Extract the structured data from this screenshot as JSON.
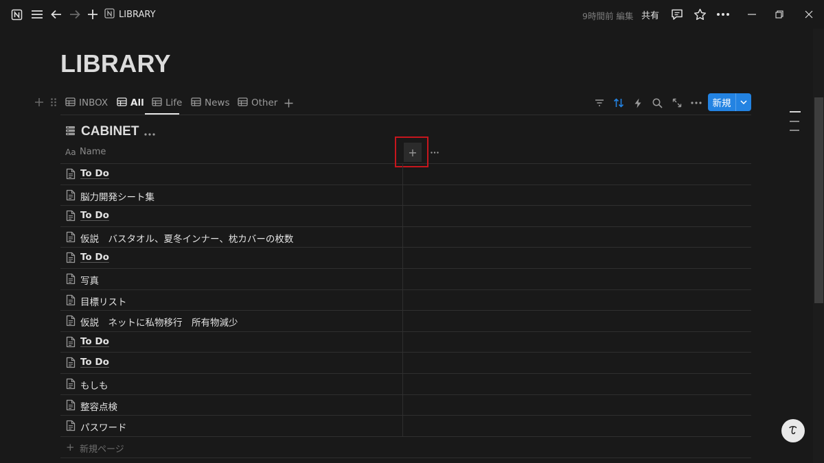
{
  "topbar": {
    "breadcrumb_label": "LIBRARY",
    "edited_text": "9時間前 編集",
    "share_label": "共有",
    "icons": [
      "notion-logo-icon",
      "menu-icon",
      "back-arrow-icon",
      "forward-arrow-icon",
      "plus-icon",
      "page-icon",
      "comment-icon",
      "star-icon",
      "more-icon",
      "minimize-icon",
      "restore-icon",
      "close-icon"
    ]
  },
  "page": {
    "title": "LIBRARY"
  },
  "views": {
    "tabs": [
      {
        "label": "INBOX",
        "active": false
      },
      {
        "label": "All",
        "active": true
      },
      {
        "label": "Life",
        "active": false
      },
      {
        "label": "News",
        "active": false
      },
      {
        "label": "Other",
        "active": false
      }
    ],
    "toolbar_icons": [
      "filter-icon",
      "sort-icon",
      "automation-icon",
      "search-icon",
      "expand-icon",
      "more-icon"
    ],
    "new_button_label": "新規"
  },
  "database": {
    "title": "CABINET",
    "header": {
      "type_label": "Aa",
      "name_label": "Name",
      "add_column_label": "+"
    },
    "rows": [
      {
        "label": "To Do",
        "bold": true
      },
      {
        "label": "脳力開発シート集",
        "bold": false
      },
      {
        "label": "To Do",
        "bold": true
      },
      {
        "label": "仮説　バスタオル、夏冬インナー、枕カバーの枚数",
        "bold": false
      },
      {
        "label": "To Do",
        "bold": true
      },
      {
        "label": "写真",
        "bold": false
      },
      {
        "label": "目標リスト",
        "bold": false
      },
      {
        "label": "仮説　ネットに私物移行　所有物減少",
        "bold": false
      },
      {
        "label": "To Do",
        "bold": true
      },
      {
        "label": "To Do",
        "bold": true
      },
      {
        "label": "もしも",
        "bold": false
      },
      {
        "label": "整容点検",
        "bold": false
      },
      {
        "label": "パスワード",
        "bold": false
      }
    ],
    "new_page_label": "新規ページ"
  },
  "help_button_label": "?",
  "colors": {
    "background": "#191919",
    "accent": "#2383e2",
    "highlight_box": "#c8161d"
  }
}
